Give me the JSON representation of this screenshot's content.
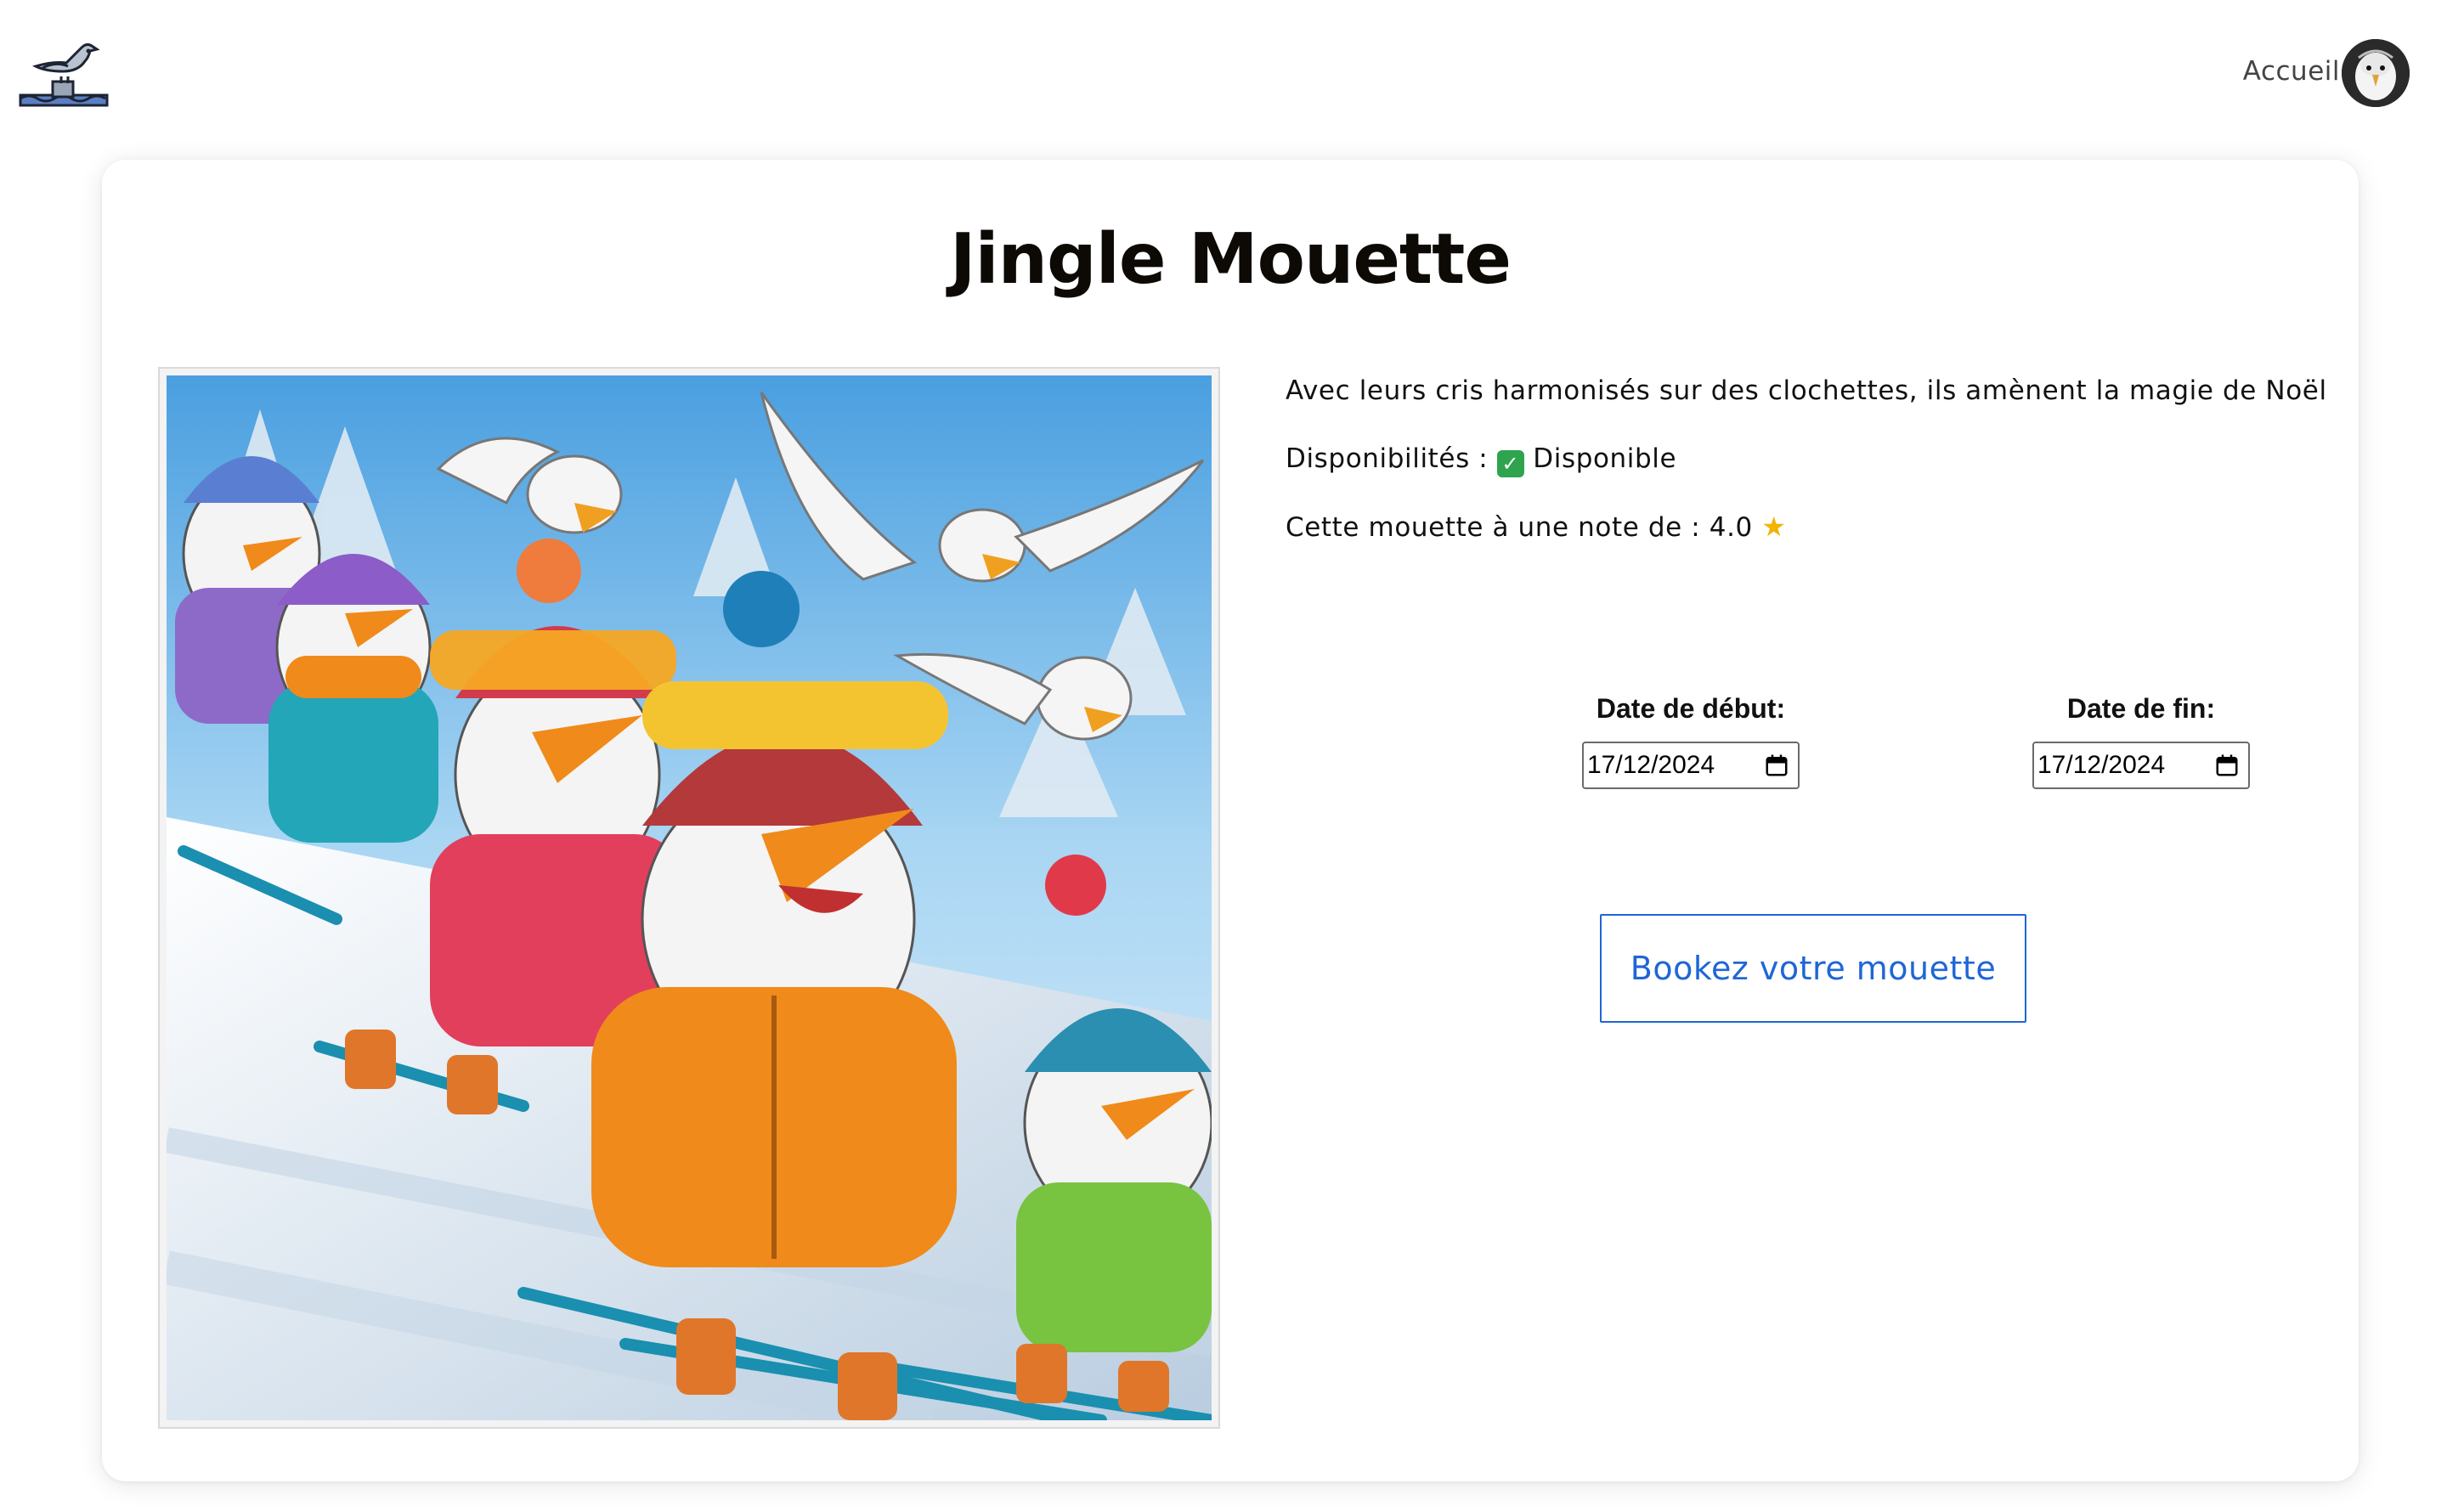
{
  "header": {
    "nav_link": "Accueil"
  },
  "product": {
    "title": "Jingle Mouette",
    "description": "Avec leurs cris harmonisés sur des clochettes, ils amènent la magie de Noël",
    "availability_label": "Disponibilités :",
    "availability_value": "Disponible",
    "rating_label": "Cette mouette à une note de :",
    "rating_value": "4.0"
  },
  "booking": {
    "start_label": "Date de début:",
    "start_value": "17/12/2024",
    "end_label": "Date de fin:",
    "end_value": "17/12/2024",
    "button_label": "Bookez votre mouette"
  },
  "icons": {
    "logo": "seagull-logo-icon",
    "availability": "check-mark-icon",
    "rating": "star-icon",
    "calendar": "calendar-icon"
  },
  "colors": {
    "accent": "#1f66d6",
    "check": "#2ea44f",
    "star": "#f2b400"
  }
}
